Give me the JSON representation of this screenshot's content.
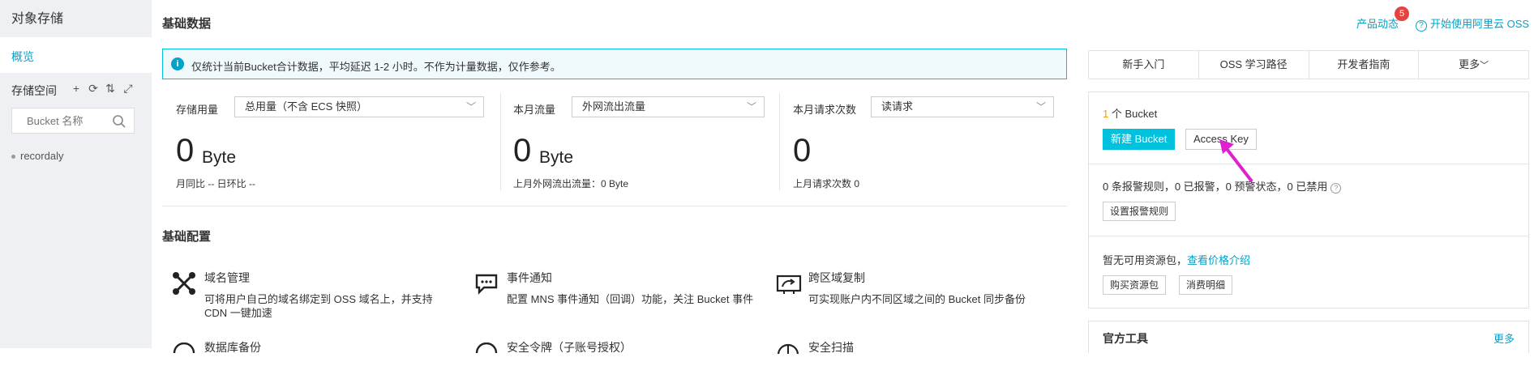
{
  "sidebar": {
    "title": "对象存储",
    "overview": "概览",
    "storage_space": "存储空间",
    "search_placeholder": "Bucket 名称",
    "buckets": [
      "recordaly"
    ]
  },
  "header": {
    "title": "基础数据",
    "news": "产品动态",
    "news_badge": "5",
    "start": "开始使用阿里云 OSS"
  },
  "notice": "仅统计当前Bucket合计数据，平均延迟 1-2 小时。不作为计量数据，仅作参考。",
  "metrics": [
    {
      "label": "存储用量",
      "select": "总用量（不含 ECS 快照）",
      "value": "0",
      "unit": "Byte",
      "sub": "月同比 --   日环比 --"
    },
    {
      "label": "本月流量",
      "select": "外网流出流量",
      "value": "0",
      "unit": "Byte",
      "sub": "上月外网流出流量：0 Byte"
    },
    {
      "label": "本月请求次数",
      "select": "读请求",
      "value": "0",
      "unit": "",
      "sub": "上月请求次数 0"
    }
  ],
  "config": {
    "title": "基础配置",
    "features": [
      {
        "title": "域名管理",
        "desc": "可将用户自己的域名绑定到 OSS 域名上，并支持 CDN 一键加速"
      },
      {
        "title": "事件通知",
        "desc": "配置 MNS 事件通知（回调）功能，关注 Bucket 事件"
      },
      {
        "title": "跨区域复制",
        "desc": "可实现账户内不同区域之间的 Bucket 同步备份"
      }
    ],
    "features_row2": [
      "数据库备份",
      "安全令牌（子账号授权）",
      "安全扫描"
    ]
  },
  "quick_tabs": [
    "新手入门",
    "OSS 学习路径",
    "开发者指南",
    "更多"
  ],
  "right_panel": {
    "bucket_count": "1",
    "bucket_label": "个 Bucket",
    "new_bucket": "新建 Bucket",
    "access_key": "Access Key",
    "alarm": "0 条报警规则，0 已报警，0 预警状态，0 已禁用",
    "alarm_button": "设置报警规则",
    "pkg_text": "暂无可用资源包，",
    "pkg_link": "查看价格介绍",
    "buy_button": "购买资源包",
    "usage_button": "消费明细"
  },
  "tools": {
    "title": "官方工具",
    "more": "更多"
  },
  "colors": {
    "accent": "#00a2ca",
    "primary_button": "#00c1de",
    "badge": "#e64340",
    "annotation_arrow": "#e020d0"
  }
}
